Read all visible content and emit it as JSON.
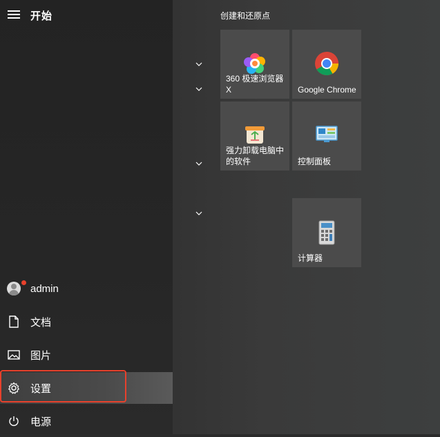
{
  "start_menu": {
    "title": "开始",
    "rail_items": {
      "user": "admin",
      "documents": "文档",
      "pictures": "图片",
      "settings": "设置",
      "power": "电源"
    }
  },
  "tiles": {
    "group_title": "创建和还原点",
    "items": [
      {
        "label": "360 极速浏览器X",
        "icon": "360-browser-icon"
      },
      {
        "label": "Google Chrome",
        "icon": "chrome-icon"
      },
      {
        "label": "强力卸载电脑中的软件",
        "icon": "uninstall-icon"
      },
      {
        "label": "控制面板",
        "icon": "control-panel-icon"
      },
      {
        "label": "计算器",
        "icon": "calculator-icon"
      }
    ]
  },
  "colors": {
    "highlight_border": "#e8412c",
    "tile_bg": "#4b4b4b"
  }
}
